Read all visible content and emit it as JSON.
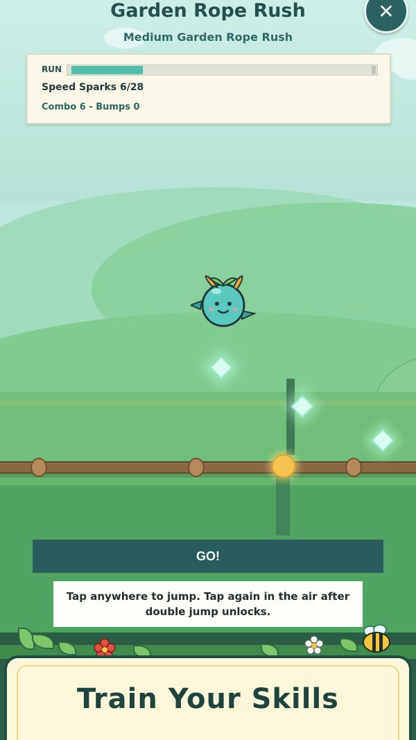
{
  "header": {
    "title": "Garden Rope Rush",
    "subtitle": "Medium Garden Rope Rush",
    "close_icon": "close-icon"
  },
  "status": {
    "run_label": "RUN",
    "run_progress": 0.24,
    "sparks_text": "Speed Sparks 6/28",
    "combo_text": "Combo 6 - Bumps 0"
  },
  "controls": {
    "go_label": "GO!",
    "hint_text": "Tap anywhere to jump. Tap again in the air after double jump unlocks."
  },
  "banner": {
    "text": "Train Your Skills"
  },
  "colors": {
    "accent": "#275e5d",
    "progress": "#4fbfa9",
    "panel": "#fbf8ea"
  }
}
